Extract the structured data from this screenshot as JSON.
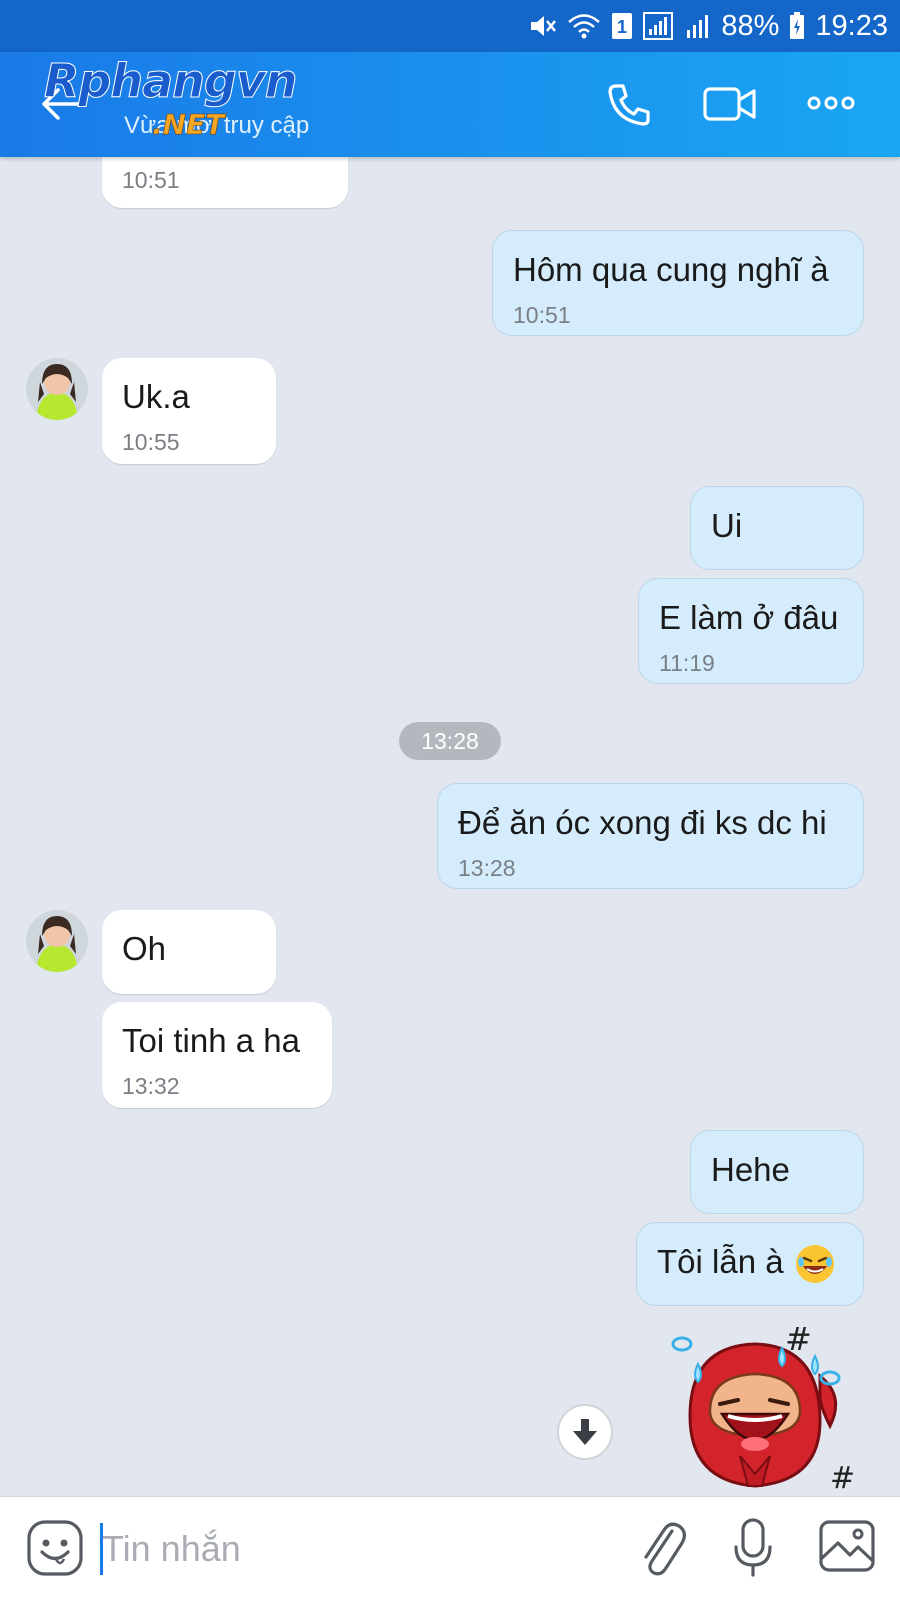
{
  "status_bar": {
    "battery": "88%",
    "time": "19:23",
    "sim_badge": "1"
  },
  "header": {
    "logo_main": "Rphangvn",
    "logo_sub": ".NET",
    "subtitle": "Vừa mới truy cập"
  },
  "messages": [
    {
      "side": "in",
      "text": "",
      "time": "10:51"
    },
    {
      "side": "out",
      "text": "Hôm qua cung nghĩ à",
      "time": "10:51"
    },
    {
      "side": "in",
      "text": "Uk.a",
      "time": "10:55"
    },
    {
      "side": "out",
      "text": "Ui",
      "time": ""
    },
    {
      "side": "out",
      "text": "E làm ở đâu",
      "time": "11:19"
    },
    {
      "side": "out",
      "text": "Để ăn óc xong đi ks dc hi",
      "time": "13:28"
    },
    {
      "side": "in",
      "text": "Oh",
      "time": ""
    },
    {
      "side": "in",
      "text": "Toi tinh a ha",
      "time": "13:32"
    },
    {
      "side": "out",
      "text": "Hehe",
      "time": ""
    },
    {
      "side": "out",
      "text": "Tôi lẫn à",
      "time": ""
    }
  ],
  "date_separator": "13:28",
  "composer": {
    "placeholder": "Tin nhắn"
  },
  "icons": {
    "call": "phone-icon",
    "video": "video-camera-icon",
    "more": "more-dots-icon",
    "emoji": "emoji-icon",
    "attach": "paperclip-icon",
    "mic": "microphone-icon",
    "image": "image-icon",
    "scroll": "arrow-down-icon"
  },
  "colors": {
    "header_start": "#1a7ae8",
    "header_end": "#1aa6f2",
    "incoming_bubble": "#ffffff",
    "outgoing_bubble": "#d4ecfc",
    "chat_background": "#e2e7ef"
  }
}
